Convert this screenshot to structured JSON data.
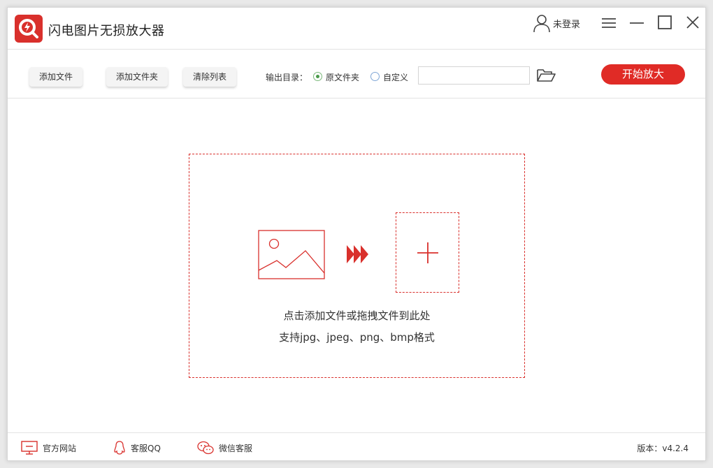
{
  "app": {
    "title": "闪电图片无损放大器",
    "logo_icon": "magnifier-bolt-logo",
    "brand_color": "#d9302c"
  },
  "header": {
    "user_label": "未登录",
    "user_icon": "user-icon",
    "window_controls": [
      "menu-icon",
      "minimize-icon",
      "maximize-icon",
      "close-icon"
    ]
  },
  "toolbar": {
    "add_file": "添加文件",
    "add_folder": "添加文件夹",
    "clear_list": "清除列表",
    "output_label": "输出目录：",
    "option_original": "原文件夹",
    "option_custom": "自定义",
    "selected_option": "原文件夹",
    "path_value": "",
    "path_placeholder": "",
    "start_button": "开始放大",
    "start_color": "#e02b26"
  },
  "dropzone": {
    "line1": "点击添加文件或拖拽文件到此处",
    "line2": "支持jpg、jpeg、png、bmp格式"
  },
  "footer": {
    "website": "官方网站",
    "qq": "客服QQ",
    "wechat": "微信客服",
    "version": "版本：v4.2.4"
  }
}
